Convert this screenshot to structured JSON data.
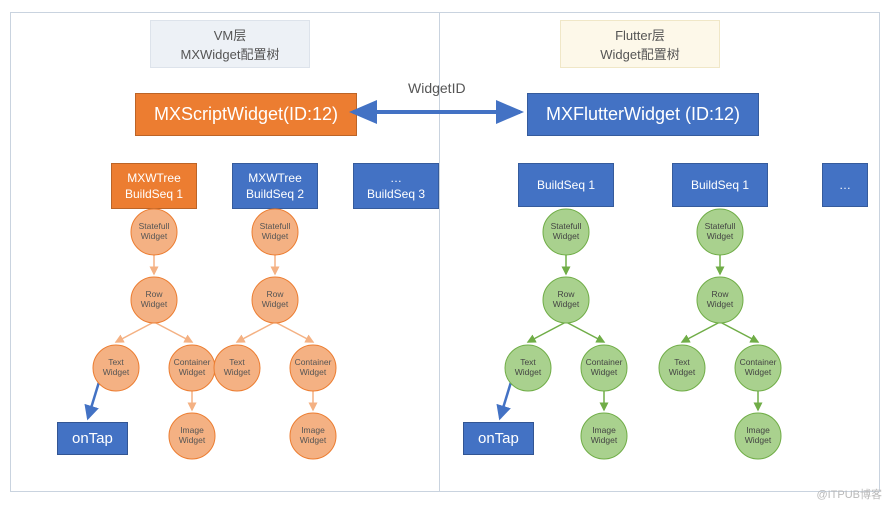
{
  "headers": {
    "vm_line1": "VM层",
    "vm_line2": "MXWidget配置树",
    "fl_line1": "Flutter层",
    "fl_line2": "Widget配置树"
  },
  "big": {
    "script": "MXScriptWidget(ID:12)",
    "flutter": "MXFlutterWidget (ID:12)"
  },
  "bridge_label": "WidgetID",
  "seq_boxes": {
    "vm1_l1": "MXWTree",
    "vm1_l2": "BuildSeq 1",
    "vm2_l1": "MXWTree",
    "vm2_l2": "BuildSeq 2",
    "vm3_l1": "…",
    "vm3_l2": "BuildSeq 3",
    "fl1": "BuildSeq 1",
    "fl2": "BuildSeq 1",
    "fl3": "…"
  },
  "nodes": {
    "stateful_l1": "Statefull",
    "stateful_l2": "Widget",
    "row_l1": "Row",
    "row_l2": "Widget",
    "text_l1": "Text",
    "text_l2": "Widget",
    "container_l1": "Container",
    "container_l2": "Widget",
    "image_l1": "Image",
    "image_l2": "Widget"
  },
  "ontap": "onTap",
  "watermark": "@ITPUB博客"
}
